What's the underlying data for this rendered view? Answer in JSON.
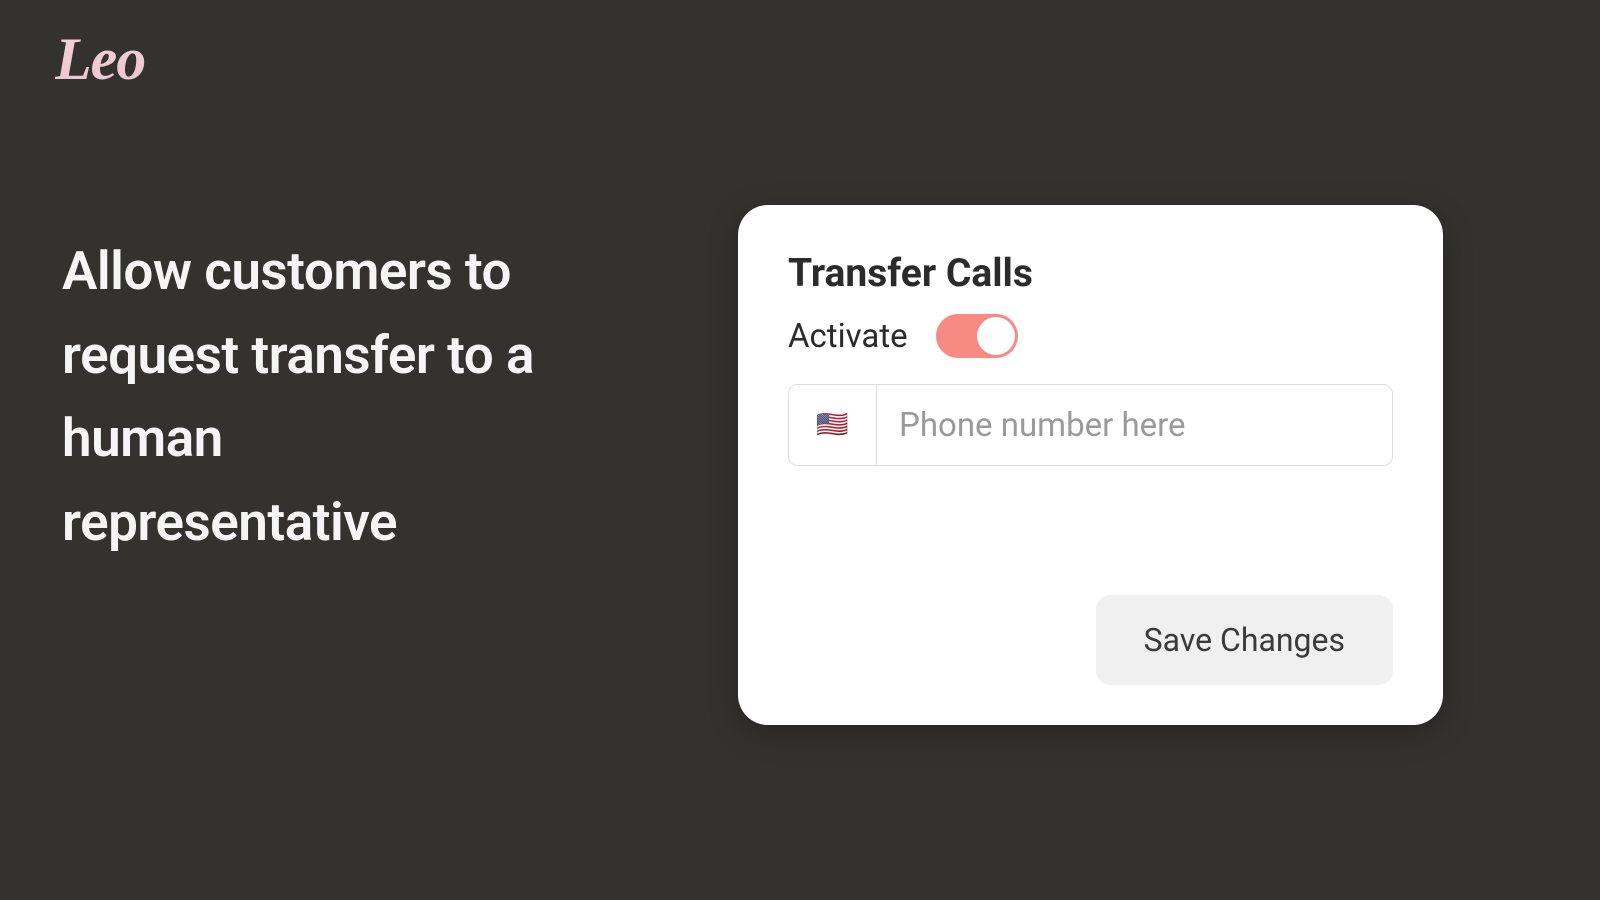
{
  "brand": {
    "logo_text": "Leo"
  },
  "headline": "Allow customers to request transfer to a human representative",
  "card": {
    "title": "Transfer Calls",
    "activate_label": "Activate",
    "activate_state": true,
    "phone": {
      "country_flag": "🇺🇸",
      "placeholder": "Phone number here",
      "value": ""
    },
    "save_button": "Save Changes"
  },
  "colors": {
    "background": "#34322f",
    "toggle_on": "#f78b84",
    "card_bg": "#ffffff"
  }
}
